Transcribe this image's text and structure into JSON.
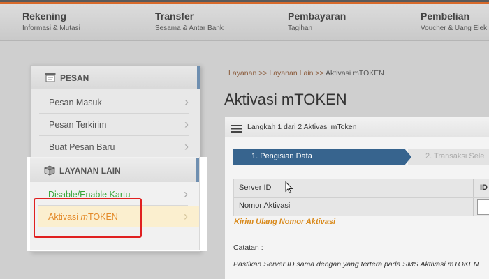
{
  "nav": [
    {
      "title": "Rekening",
      "subtitle": "Informasi & Mutasi"
    },
    {
      "title": "Transfer",
      "subtitle": "Sesama & Antar Bank"
    },
    {
      "title": "Pembayaran",
      "subtitle": "Tagihan"
    },
    {
      "title": "Pembelian",
      "subtitle": "Voucher & Uang Elek"
    }
  ],
  "sidebar": {
    "pesan": {
      "heading": "PESAN",
      "items": [
        {
          "label": "Pesan Masuk"
        },
        {
          "label": "Pesan Terkirim"
        },
        {
          "label": "Buat Pesan Baru"
        }
      ]
    },
    "layanan": {
      "heading": "LAYANAN LAIN",
      "items": [
        {
          "label": "Disable/Enable Kartu"
        },
        {
          "label_prefix": "Aktivasi ",
          "label_emph": "m",
          "label_suffix": "TOKEN"
        }
      ]
    }
  },
  "breadcrumb": {
    "part1": "Layanan",
    "sep1": " >> ",
    "part2": "Layanan Lain",
    "sep2": " >> ",
    "current": "Aktivasi mTOKEN"
  },
  "page_title": "Aktivasi mTOKEN",
  "step_header": "Langkah 1 dari 2 Aktivasi mToken",
  "steps": [
    {
      "label": "1. Pengisian Data",
      "active": true
    },
    {
      "label": "2. Transaksi Sele",
      "active": false
    }
  ],
  "form": {
    "server_id_label": "Server ID",
    "server_id_value": "ID",
    "nomor_label": "Nomor Aktivasi"
  },
  "resend_link": "Kirim Ulang Nomor Aktivasi",
  "catatan_label": "Catatan :",
  "note": "Pastikan Server ID sama dengan yang tertera pada SMS Aktivasi mTOKEN",
  "colors": {
    "accent": "#d86a2b",
    "step_active": "#37648e",
    "highlight": "#e02020",
    "link_green": "#3aa53a",
    "link_orange": "#e38a2a"
  }
}
